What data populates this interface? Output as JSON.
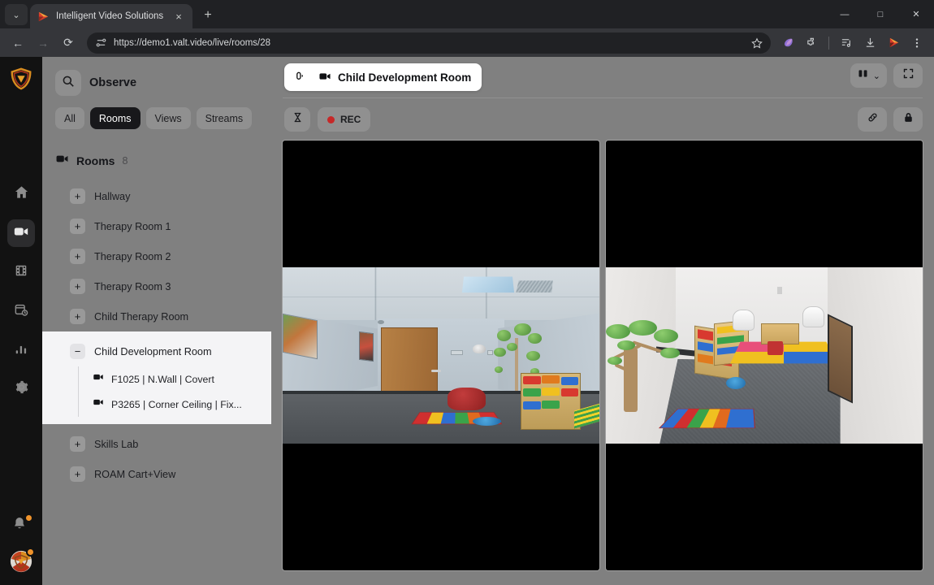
{
  "browser": {
    "tab": {
      "title": "Intelligent Video Solutions",
      "favicon_name": "ivs-play-favicon",
      "close_label": "×"
    },
    "new_tab_label": "+",
    "tab_list_label": "⌄",
    "window_controls": {
      "minimize": "—",
      "maximize": "□",
      "close": "✕"
    },
    "nav": {
      "back": "←",
      "forward": "→",
      "reload": "⟳"
    },
    "omnibox": {
      "url": "https://demo1.valt.video/live/rooms/28",
      "site_info_icon": "page-info-icon",
      "bookmark_icon": "star-icon"
    },
    "toolbar_icons": [
      {
        "name": "gemini-icon",
        "glyph": "◗"
      },
      {
        "name": "extensions-icon",
        "glyph": "⬡"
      },
      {
        "name": "reading-list-icon",
        "glyph": "≡"
      },
      {
        "name": "downloads-icon",
        "glyph": "⬇"
      },
      {
        "name": "ivs-extension-icon",
        "glyph": "▶"
      },
      {
        "name": "chrome-menu-icon",
        "glyph": "⋮"
      }
    ]
  },
  "rail": {
    "logo_name": "valt-shield-logo",
    "items": [
      {
        "name": "sidebar-item-home",
        "icon": "home-icon",
        "active": false
      },
      {
        "name": "sidebar-item-observe",
        "icon": "video-camera-icon",
        "active": true
      },
      {
        "name": "sidebar-item-review",
        "icon": "film-strip-icon",
        "active": false
      },
      {
        "name": "sidebar-item-schedule",
        "icon": "calendar-clock-icon",
        "active": false
      },
      {
        "name": "sidebar-item-reports",
        "icon": "bar-chart-icon",
        "active": false
      },
      {
        "name": "sidebar-item-settings",
        "icon": "gear-icon",
        "active": false
      }
    ],
    "bottom": [
      {
        "name": "notifications-bell",
        "icon": "bell-icon",
        "has_badge": true
      },
      {
        "name": "user-avatar",
        "icon": "avatar-icon",
        "has_badge": true
      }
    ]
  },
  "sidebar": {
    "title": "Observe",
    "search_icon": "search-icon",
    "filters": [
      {
        "label": "All",
        "active": false
      },
      {
        "label": "Rooms",
        "active": true
      },
      {
        "label": "Views",
        "active": false
      },
      {
        "label": "Streams",
        "active": false
      }
    ],
    "group": {
      "icon": "video-camera-icon",
      "title": "Rooms",
      "count": "8"
    },
    "rooms": [
      {
        "label": "Hallway",
        "toggle": "+",
        "expanded": false,
        "cameras": []
      },
      {
        "label": "Therapy Room 1",
        "toggle": "+",
        "expanded": false,
        "cameras": []
      },
      {
        "label": "Therapy Room 2",
        "toggle": "+",
        "expanded": false,
        "cameras": []
      },
      {
        "label": "Therapy Room 3",
        "toggle": "+",
        "expanded": false,
        "cameras": []
      },
      {
        "label": "Child Therapy Room",
        "toggle": "+",
        "expanded": false,
        "cameras": []
      },
      {
        "label": "Child Development Room",
        "toggle": "−",
        "expanded": true,
        "cameras": [
          {
            "label": "F1025 | N.Wall | Covert",
            "icon": "video-camera-icon"
          },
          {
            "label": "P3265 | Corner Ceiling | Fix...",
            "icon": "video-camera-icon"
          }
        ]
      },
      {
        "label": "Skills Lab",
        "toggle": "+",
        "expanded": false,
        "cameras": []
      },
      {
        "label": "ROAM Cart+View",
        "toggle": "+",
        "expanded": false,
        "cameras": []
      }
    ]
  },
  "stage": {
    "room_tab": {
      "mic_icon": "microphone-off-icon",
      "camera_icon": "video-camera-icon",
      "title": "Child Development Room"
    },
    "header_controls": [
      {
        "name": "layout-selector-button",
        "icon": "two-column-layout-icon",
        "chevron": "⌄"
      },
      {
        "name": "fullscreen-button",
        "icon": "fullscreen-icon"
      }
    ],
    "tools": {
      "timer_button": {
        "name": "timer-button",
        "icon": "hourglass-icon"
      },
      "rec_badge": {
        "name": "rec-status-badge",
        "label": "REC",
        "dot_color": "#c62828"
      }
    },
    "tools_right": [
      {
        "name": "share-link-button",
        "icon": "link-icon"
      },
      {
        "name": "lock-button",
        "icon": "lock-icon"
      }
    ],
    "videos": [
      {
        "name": "video-tile-f1025",
        "camera": "F1025 | N.Wall | Covert",
        "scene": "covert-wall-view"
      },
      {
        "name": "video-tile-p3265",
        "camera": "P3265 | Corner Ceiling | Fix...",
        "scene": "corner-ceiling-view"
      }
    ]
  },
  "colors": {
    "browser_bg": "#202124",
    "toolbar_bg": "#35363a",
    "app_bg": "#808080",
    "rail_bg": "#121212",
    "accent_orange": "#f0932b",
    "rec_red": "#c62828",
    "active_pill": "#18181b",
    "expanded_panel": "#f4f4f6"
  }
}
